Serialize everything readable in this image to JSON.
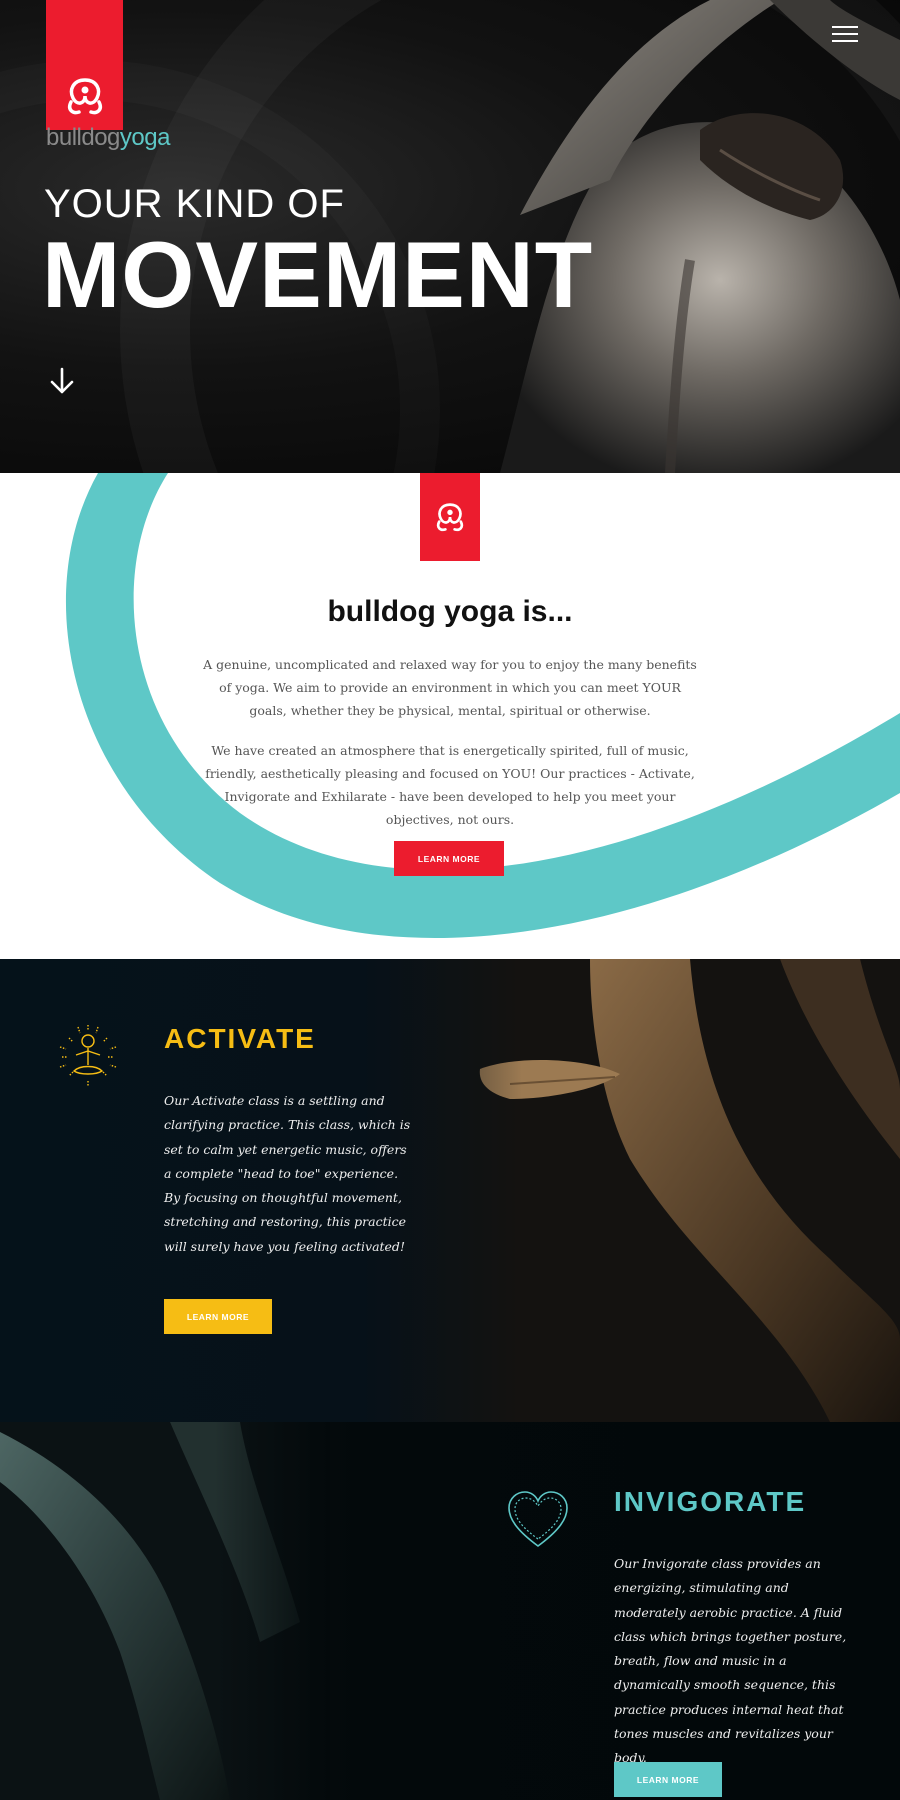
{
  "brand": {
    "word_part1": "bulldog",
    "word_part2": "yoga",
    "accent_red": "#ec1c2e",
    "accent_teal": "#5ec8c7",
    "accent_yellow": "#f6bd14"
  },
  "hero": {
    "kicker": "YOUR KIND OF",
    "title": "MOVEMENT",
    "menu_icon": "hamburger-icon",
    "scroll_icon": "arrow-down-icon"
  },
  "about": {
    "title": "bulldog yoga is...",
    "paragraph1": "A genuine, uncomplicated and relaxed way for you to enjoy the many benefits of yoga. We aim to provide an environment in which you can meet YOUR goals, whether they be physical, mental, spiritual or otherwise.",
    "paragraph2": "We have created an atmosphere that is energetically spirited, full of music, friendly, aesthetically pleasing and focused on YOU! Our practices - Activate, Invigorate and Exhilarate - have been developed to help you meet your objectives, not ours.",
    "button": "LEARN MORE"
  },
  "activate": {
    "title": "ACTIVATE",
    "icon": "meditation-icon",
    "text": "Our Activate class is a settling and clarifying practice. This class, which is set to calm yet energetic music, offers a complete \"head to toe\" experience. By focusing on thoughtful movement, stretching and restoring, this practice will surely have you feeling activated!",
    "button": "LEARN MORE"
  },
  "invigorate": {
    "title": "INVIGORATE",
    "icon": "heart-icon",
    "text": "Our Invigorate class provides an energizing, stimulating and moderately aerobic practice. A fluid class which brings together posture, breath, flow and music in a dynamically smooth sequence, this practice produces internal heat that tones muscles and revitalizes your body.",
    "button": "LEARN MORE"
  }
}
